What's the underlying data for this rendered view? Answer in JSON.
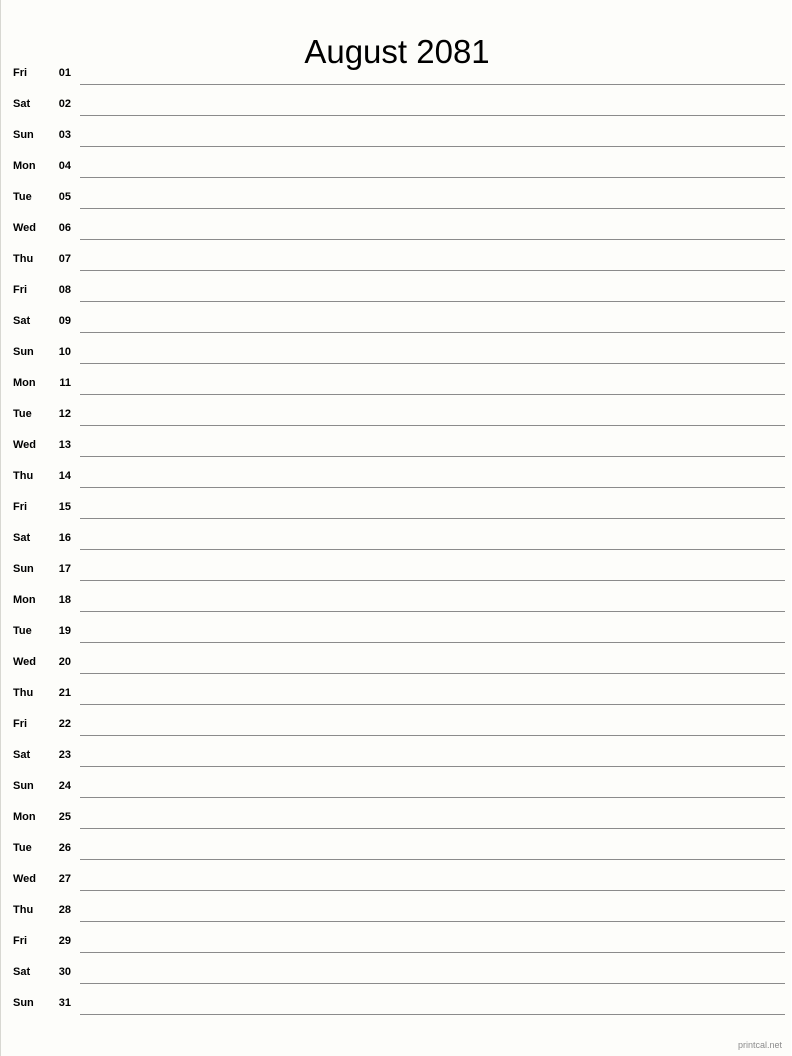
{
  "document": {
    "title": "August 2081",
    "month": "August",
    "year": "2081",
    "type": "monthly-notes-calendar"
  },
  "colors": {
    "background": "#fdfdfa",
    "text": "#000000",
    "rule": "#8b8b8b",
    "footer_text": "#8c8c8c",
    "page_border": "#d8d8d2"
  },
  "days": [
    {
      "weekday": "Fri",
      "number": "01"
    },
    {
      "weekday": "Sat",
      "number": "02"
    },
    {
      "weekday": "Sun",
      "number": "03"
    },
    {
      "weekday": "Mon",
      "number": "04"
    },
    {
      "weekday": "Tue",
      "number": "05"
    },
    {
      "weekday": "Wed",
      "number": "06"
    },
    {
      "weekday": "Thu",
      "number": "07"
    },
    {
      "weekday": "Fri",
      "number": "08"
    },
    {
      "weekday": "Sat",
      "number": "09"
    },
    {
      "weekday": "Sun",
      "number": "10"
    },
    {
      "weekday": "Mon",
      "number": "11"
    },
    {
      "weekday": "Tue",
      "number": "12"
    },
    {
      "weekday": "Wed",
      "number": "13"
    },
    {
      "weekday": "Thu",
      "number": "14"
    },
    {
      "weekday": "Fri",
      "number": "15"
    },
    {
      "weekday": "Sat",
      "number": "16"
    },
    {
      "weekday": "Sun",
      "number": "17"
    },
    {
      "weekday": "Mon",
      "number": "18"
    },
    {
      "weekday": "Tue",
      "number": "19"
    },
    {
      "weekday": "Wed",
      "number": "20"
    },
    {
      "weekday": "Thu",
      "number": "21"
    },
    {
      "weekday": "Fri",
      "number": "22"
    },
    {
      "weekday": "Sat",
      "number": "23"
    },
    {
      "weekday": "Sun",
      "number": "24"
    },
    {
      "weekday": "Mon",
      "number": "25"
    },
    {
      "weekday": "Tue",
      "number": "26"
    },
    {
      "weekday": "Wed",
      "number": "27"
    },
    {
      "weekday": "Thu",
      "number": "28"
    },
    {
      "weekday": "Fri",
      "number": "29"
    },
    {
      "weekday": "Sat",
      "number": "30"
    },
    {
      "weekday": "Sun",
      "number": "31"
    }
  ],
  "footer": {
    "credit": "printcal.net"
  }
}
